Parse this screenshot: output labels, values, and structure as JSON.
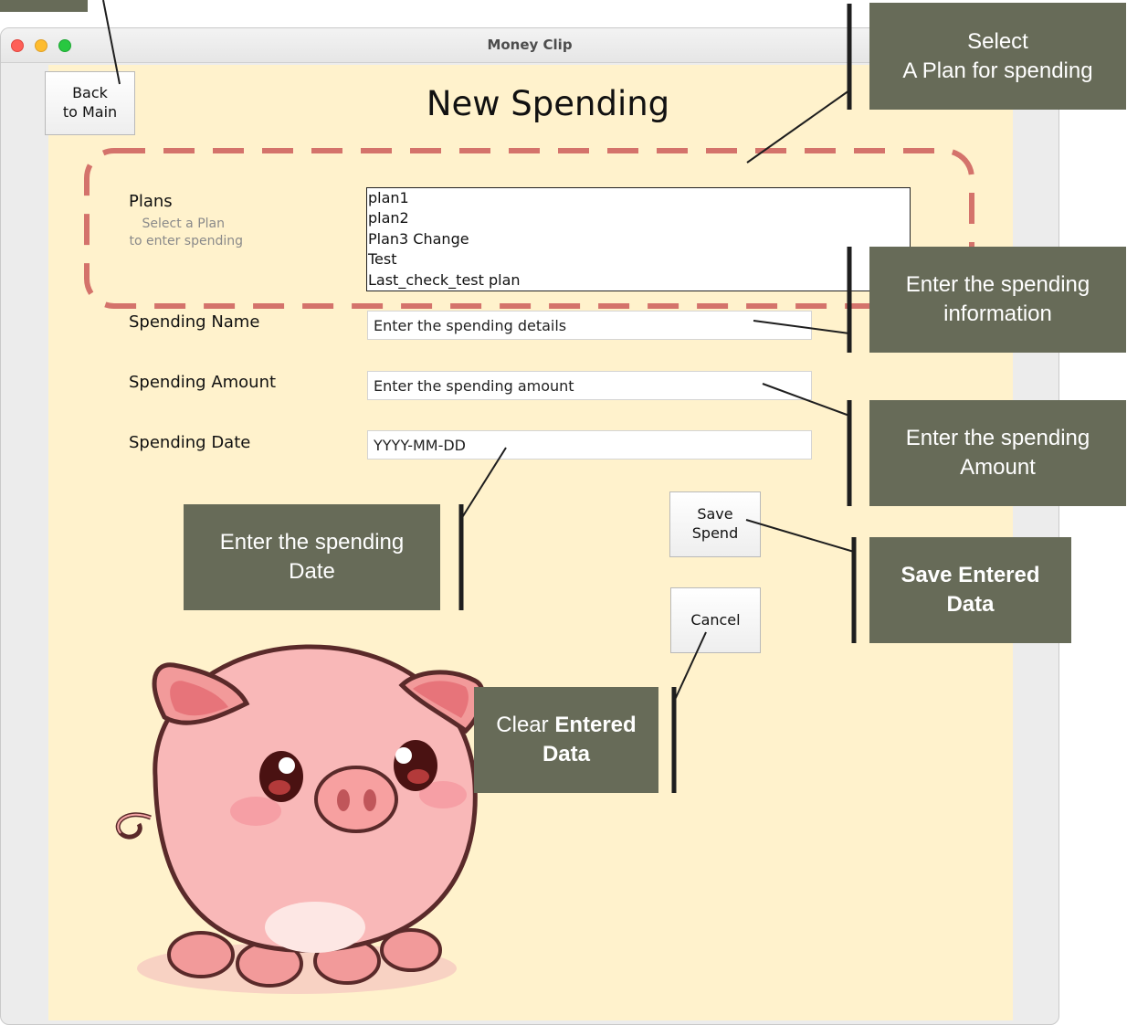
{
  "window": {
    "title": "Money Clip"
  },
  "page": {
    "title": "New Spending",
    "back_button_line1": "Back",
    "back_button_line2": "to Main"
  },
  "plans": {
    "label": "Plans",
    "hint_line1": "Select a Plan",
    "hint_line2": "to enter spending",
    "items": [
      "plan1",
      "plan2",
      "Plan3 Change",
      "Test",
      "Last_check_test plan"
    ]
  },
  "spending_name": {
    "label": "Spending Name",
    "placeholder": "Enter the spending details"
  },
  "spending_amount": {
    "label": "Spending Amount",
    "placeholder": "Enter the spending amount"
  },
  "spending_date": {
    "label": "Spending Date",
    "placeholder": "YYYY-MM-DD"
  },
  "buttons": {
    "save_line1": "Save",
    "save_line2": "Spend",
    "cancel": "Cancel"
  },
  "annotations": {
    "select_plan_line1": "Select",
    "select_plan_line2": "A Plan for spending",
    "spending_info_line1": "Enter the spending",
    "spending_info_line2": "information",
    "spending_amount_line1": "Enter the spending",
    "spending_amount_line2": "Amount",
    "save_line1": "Save Entered",
    "save_line2": "Data",
    "date_line1": "Enter the spending",
    "date_line2": "Date",
    "clear_word1": "Clear",
    "clear_word2": "Entered",
    "clear_line2": "Data"
  },
  "colors": {
    "content_background": "#fff2cc",
    "callout_background": "#676b58",
    "dashed_outline": "#d4736b",
    "callout_text": "#ffffff"
  },
  "icons": {
    "pig": "piggy-mascot-illustration",
    "window_controls": [
      "close-traffic-light",
      "minimize-traffic-light",
      "zoom-traffic-light"
    ]
  }
}
